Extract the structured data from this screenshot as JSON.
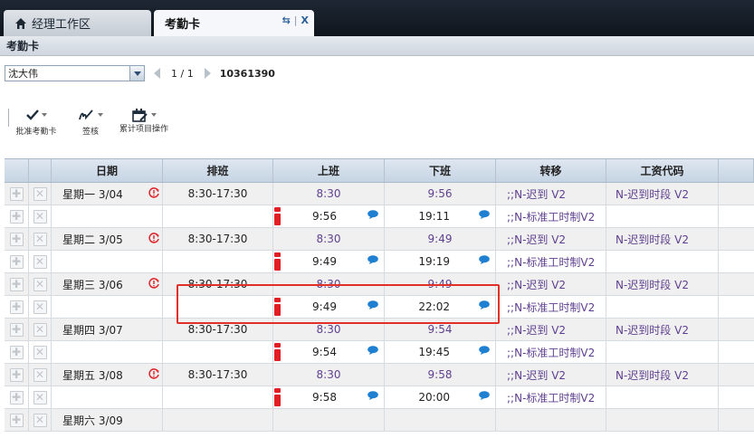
{
  "tabs": {
    "home_label": "经理工作区",
    "active_label": "考勤卡",
    "refresh_glyph": "⇆",
    "separator": "|",
    "close_glyph": "X"
  },
  "section_title": "考勤卡",
  "selector": {
    "employee": "沈大伟",
    "pager": "1 / 1",
    "employee_id": "10361390"
  },
  "toolbar": {
    "approve_label": "批准考勤卡",
    "sign_label": "签核",
    "cumulative_label": "累计项目操作"
  },
  "columns": [
    "日期",
    "排班",
    "上班",
    "下班",
    "转移",
    "工资代码"
  ],
  "rows": [
    {
      "kind": "day",
      "date": "星期一 3/04",
      "warn": true,
      "schedule": "8:30-17:30",
      "in": "8:30",
      "out": "9:56",
      "transfer": ";;N-迟到 V2",
      "paycode": "N-迟到时段 V2"
    },
    {
      "kind": "punch",
      "in": "9:56",
      "out": "19:11",
      "transfer": ";;N-标准工时制V2"
    },
    {
      "kind": "day",
      "date": "星期二 3/05",
      "warn": true,
      "schedule": "8:30-17:30",
      "in": "8:30",
      "out": "9:49",
      "transfer": ";;N-迟到 V2",
      "paycode": "N-迟到时段 V2"
    },
    {
      "kind": "punch",
      "in": "9:49",
      "out": "19:19",
      "transfer": ";;N-标准工时制V2"
    },
    {
      "kind": "day",
      "date": "星期三 3/06",
      "warn": true,
      "schedule": "8:30-17:30",
      "in": "8:30",
      "out": "9:49",
      "transfer": ";;N-迟到 V2",
      "paycode": "N-迟到时段 V2"
    },
    {
      "kind": "punch",
      "in": "9:49",
      "out": "22:02",
      "transfer": ";;N-标准工时制V2"
    },
    {
      "kind": "day",
      "date": "星期四 3/07",
      "warn": false,
      "schedule": "8:30-17:30",
      "in": "8:30",
      "out": "9:54",
      "transfer": ";;N-迟到 V2",
      "paycode": "N-迟到时段 V2"
    },
    {
      "kind": "punch",
      "in": "9:54",
      "out": "19:45",
      "transfer": ";;N-标准工时制V2"
    },
    {
      "kind": "day",
      "date": "星期五 3/08",
      "warn": true,
      "schedule": "8:30-17:30",
      "in": "8:30",
      "out": "9:58",
      "transfer": ";;N-迟到 V2",
      "paycode": "N-迟到时段 V2"
    },
    {
      "kind": "punch",
      "in": "9:58",
      "out": "20:00",
      "transfer": ";;N-标准工时制V2"
    },
    {
      "kind": "day",
      "date": "星期六 3/09",
      "warn": false,
      "schedule": "",
      "in": "",
      "out": "",
      "transfer": "",
      "paycode": ""
    }
  ],
  "colors": {
    "accent_red": "#e12025",
    "value_purple": "#5e3f8f",
    "bubble_blue": "#1f7fd1"
  }
}
